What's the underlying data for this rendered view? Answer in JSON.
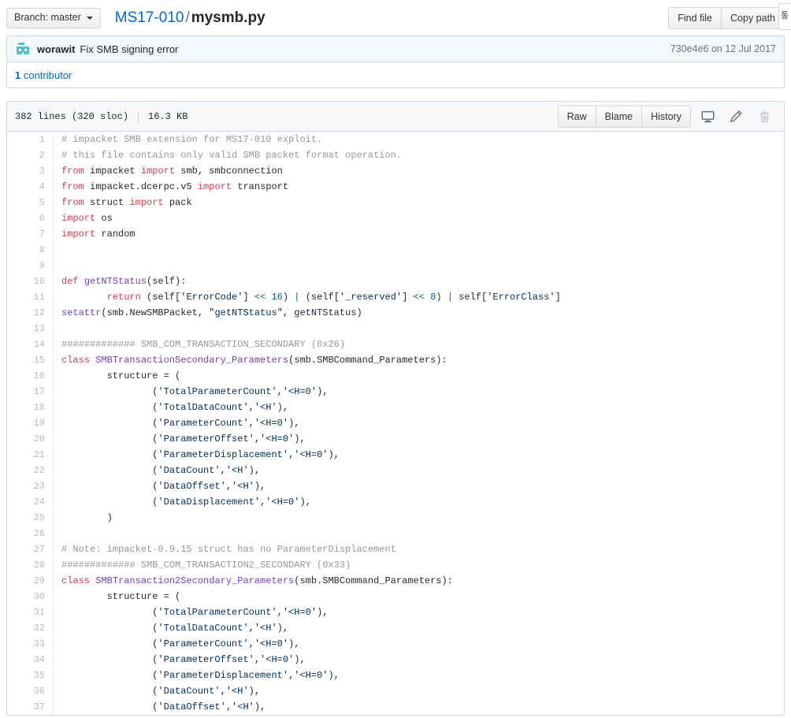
{
  "topbar": {
    "branch_label": "Branch: master",
    "breadcrumb": {
      "repo": "MS17-010",
      "separator": "/",
      "file": "mysmb.py"
    },
    "find_file_label": "Find file",
    "copy_path_label": "Copy path",
    "clipped_widget_text": "통"
  },
  "commit": {
    "author": "worawit",
    "message": "Fix SMB signing error",
    "meta": "730e4e6 on 12 Jul 2017",
    "avatar_color": "#4fc3c9"
  },
  "contributors": {
    "count": "1",
    "label": " contributor"
  },
  "file": {
    "lines_label": "382 lines (320 sloc)",
    "size_label": "16.3 KB",
    "actions": {
      "raw": "Raw",
      "blame": "Blame",
      "history": "History",
      "desktop_icon": "desktop-icon",
      "edit_icon": "pencil-icon",
      "delete_icon": "trash-icon"
    }
  },
  "code": {
    "language": "python",
    "lines": [
      {
        "n": 1,
        "tokens": [
          [
            "c",
            "# impacket SMB extension for MS17-010 exploit."
          ]
        ]
      },
      {
        "n": 2,
        "tokens": [
          [
            "c",
            "# this file contains only valid SMB packet format operation."
          ]
        ]
      },
      {
        "n": 3,
        "tokens": [
          [
            "k",
            "from"
          ],
          [
            "n",
            " impacket "
          ],
          [
            "k",
            "import"
          ],
          [
            "n",
            " smb, smbconnection"
          ]
        ]
      },
      {
        "n": 4,
        "tokens": [
          [
            "k",
            "from"
          ],
          [
            "n",
            " impacket.dcerpc.v5 "
          ],
          [
            "k",
            "import"
          ],
          [
            "n",
            " transport"
          ]
        ]
      },
      {
        "n": 5,
        "tokens": [
          [
            "k",
            "from"
          ],
          [
            "n",
            " struct "
          ],
          [
            "k",
            "import"
          ],
          [
            "n",
            " pack"
          ]
        ]
      },
      {
        "n": 6,
        "tokens": [
          [
            "k",
            "import"
          ],
          [
            "n",
            " os"
          ]
        ]
      },
      {
        "n": 7,
        "tokens": [
          [
            "k",
            "import"
          ],
          [
            "n",
            " random"
          ]
        ]
      },
      {
        "n": 8,
        "tokens": []
      },
      {
        "n": 9,
        "tokens": []
      },
      {
        "n": 10,
        "tokens": [
          [
            "k",
            "def"
          ],
          [
            "n",
            " "
          ],
          [
            "nf",
            "getNTStatus"
          ],
          [
            "n",
            "(self):"
          ]
        ]
      },
      {
        "n": 11,
        "tokens": [
          [
            "n",
            "        "
          ],
          [
            "k",
            "return"
          ],
          [
            "n",
            " (self["
          ],
          [
            "s",
            "'ErrorCode'"
          ],
          [
            "n",
            "] "
          ],
          [
            "o",
            "<<"
          ],
          [
            "n",
            " "
          ],
          [
            "mi",
            "16"
          ],
          [
            "n",
            ") "
          ],
          [
            "o",
            "|"
          ],
          [
            "n",
            " (self["
          ],
          [
            "s",
            "'_reserved'"
          ],
          [
            "n",
            "] "
          ],
          [
            "o",
            "<<"
          ],
          [
            "n",
            " "
          ],
          [
            "mi",
            "8"
          ],
          [
            "n",
            ") "
          ],
          [
            "o",
            "|"
          ],
          [
            "n",
            " self["
          ],
          [
            "s",
            "'ErrorClass'"
          ],
          [
            "n",
            "]"
          ]
        ]
      },
      {
        "n": 12,
        "tokens": [
          [
            "nb",
            "setattr"
          ],
          [
            "n",
            "(smb.NewSMBPacket, "
          ],
          [
            "s",
            "\"getNTStatus\""
          ],
          [
            "n",
            ", getNTStatus)"
          ]
        ]
      },
      {
        "n": 13,
        "tokens": []
      },
      {
        "n": 14,
        "tokens": [
          [
            "c",
            "############# SMB_COM_TRANSACTION_SECONDARY (0x26)"
          ]
        ]
      },
      {
        "n": 15,
        "tokens": [
          [
            "k",
            "class"
          ],
          [
            "n",
            " "
          ],
          [
            "nf",
            "SMBTransactionSecondary_Parameters"
          ],
          [
            "n",
            "(smb.SMBCommand_Parameters):"
          ]
        ]
      },
      {
        "n": 16,
        "tokens": [
          [
            "n",
            "        structure = ("
          ]
        ]
      },
      {
        "n": 17,
        "tokens": [
          [
            "n",
            "                ("
          ],
          [
            "s",
            "'TotalParameterCount'"
          ],
          [
            "n",
            ","
          ],
          [
            "s",
            "'<H=0'"
          ],
          [
            "n",
            "),"
          ]
        ]
      },
      {
        "n": 18,
        "tokens": [
          [
            "n",
            "                ("
          ],
          [
            "s",
            "'TotalDataCount'"
          ],
          [
            "n",
            ","
          ],
          [
            "s",
            "'<H'"
          ],
          [
            "n",
            "),"
          ]
        ]
      },
      {
        "n": 19,
        "tokens": [
          [
            "n",
            "                ("
          ],
          [
            "s",
            "'ParameterCount'"
          ],
          [
            "n",
            ","
          ],
          [
            "s",
            "'<H=0'"
          ],
          [
            "n",
            "),"
          ]
        ]
      },
      {
        "n": 20,
        "tokens": [
          [
            "n",
            "                ("
          ],
          [
            "s",
            "'ParameterOffset'"
          ],
          [
            "n",
            ","
          ],
          [
            "s",
            "'<H=0'"
          ],
          [
            "n",
            "),"
          ]
        ]
      },
      {
        "n": 21,
        "tokens": [
          [
            "n",
            "                ("
          ],
          [
            "s",
            "'ParameterDisplacement'"
          ],
          [
            "n",
            ","
          ],
          [
            "s",
            "'<H=0'"
          ],
          [
            "n",
            "),"
          ]
        ]
      },
      {
        "n": 22,
        "tokens": [
          [
            "n",
            "                ("
          ],
          [
            "s",
            "'DataCount'"
          ],
          [
            "n",
            ","
          ],
          [
            "s",
            "'<H'"
          ],
          [
            "n",
            "),"
          ]
        ]
      },
      {
        "n": 23,
        "tokens": [
          [
            "n",
            "                ("
          ],
          [
            "s",
            "'DataOffset'"
          ],
          [
            "n",
            ","
          ],
          [
            "s",
            "'<H'"
          ],
          [
            "n",
            "),"
          ]
        ]
      },
      {
        "n": 24,
        "tokens": [
          [
            "n",
            "                ("
          ],
          [
            "s",
            "'DataDisplacement'"
          ],
          [
            "n",
            ","
          ],
          [
            "s",
            "'<H=0'"
          ],
          [
            "n",
            "),"
          ]
        ]
      },
      {
        "n": 25,
        "tokens": [
          [
            "n",
            "        )"
          ]
        ]
      },
      {
        "n": 26,
        "tokens": []
      },
      {
        "n": 27,
        "tokens": [
          [
            "c",
            "# Note: impacket-0.9.15 struct has no ParameterDisplacement"
          ]
        ]
      },
      {
        "n": 28,
        "tokens": [
          [
            "c",
            "############# SMB_COM_TRANSACTION2_SECONDARY (0x33)"
          ]
        ]
      },
      {
        "n": 29,
        "tokens": [
          [
            "k",
            "class"
          ],
          [
            "n",
            " "
          ],
          [
            "nf",
            "SMBTransaction2Secondary_Parameters"
          ],
          [
            "n",
            "(smb.SMBCommand_Parameters):"
          ]
        ]
      },
      {
        "n": 30,
        "tokens": [
          [
            "n",
            "        structure = ("
          ]
        ]
      },
      {
        "n": 31,
        "tokens": [
          [
            "n",
            "                ("
          ],
          [
            "s",
            "'TotalParameterCount'"
          ],
          [
            "n",
            ","
          ],
          [
            "s",
            "'<H=0'"
          ],
          [
            "n",
            "),"
          ]
        ]
      },
      {
        "n": 32,
        "tokens": [
          [
            "n",
            "                ("
          ],
          [
            "s",
            "'TotalDataCount'"
          ],
          [
            "n",
            ","
          ],
          [
            "s",
            "'<H'"
          ],
          [
            "n",
            "),"
          ]
        ]
      },
      {
        "n": 33,
        "tokens": [
          [
            "n",
            "                ("
          ],
          [
            "s",
            "'ParameterCount'"
          ],
          [
            "n",
            ","
          ],
          [
            "s",
            "'<H=0'"
          ],
          [
            "n",
            "),"
          ]
        ]
      },
      {
        "n": 34,
        "tokens": [
          [
            "n",
            "                ("
          ],
          [
            "s",
            "'ParameterOffset'"
          ],
          [
            "n",
            ","
          ],
          [
            "s",
            "'<H=0'"
          ],
          [
            "n",
            "),"
          ]
        ]
      },
      {
        "n": 35,
        "tokens": [
          [
            "n",
            "                ("
          ],
          [
            "s",
            "'ParameterDisplacement'"
          ],
          [
            "n",
            ","
          ],
          [
            "s",
            "'<H=0'"
          ],
          [
            "n",
            "),"
          ]
        ]
      },
      {
        "n": 36,
        "tokens": [
          [
            "n",
            "                ("
          ],
          [
            "s",
            "'DataCount'"
          ],
          [
            "n",
            ","
          ],
          [
            "s",
            "'<H'"
          ],
          [
            "n",
            "),"
          ]
        ]
      },
      {
        "n": 37,
        "tokens": [
          [
            "n",
            "                ("
          ],
          [
            "s",
            "'DataOffset'"
          ],
          [
            "n",
            ","
          ],
          [
            "s",
            "'<H'"
          ],
          [
            "n",
            "),"
          ]
        ]
      }
    ]
  }
}
